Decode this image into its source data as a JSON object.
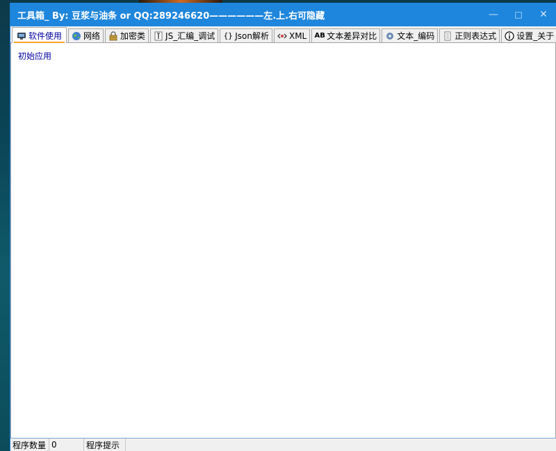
{
  "window": {
    "title": "工具箱_ By:  豆浆与油条 or QQ:289246620——————左.上.右可隐藏",
    "minimize_glyph": "—",
    "maximize_glyph": "□",
    "close_glyph": "✕"
  },
  "tabs": [
    {
      "label": "软件使用",
      "icon": "software-icon",
      "active": true
    },
    {
      "label": "网络",
      "icon": "globe-icon"
    },
    {
      "label": "加密类",
      "icon": "encrypt-icon"
    },
    {
      "label": "JS_汇编_调试",
      "icon": "js-icon"
    },
    {
      "label": "Json解析",
      "icon": "json-icon"
    },
    {
      "label": "XML",
      "icon": "xml-icon"
    },
    {
      "label": "文本差异对比",
      "icon": "text-diff-icon"
    },
    {
      "label": "文本_编码",
      "icon": "encoding-icon"
    },
    {
      "label": "正则表达式",
      "icon": "regex-icon"
    },
    {
      "label": "设置_关于",
      "icon": "info-icon"
    }
  ],
  "content": {
    "app_link": "初始应用"
  },
  "statusbar": {
    "count_label": "程序数量",
    "count_value": "0",
    "hint_label": "程序提示"
  },
  "colors": {
    "titlebar": "#1e86dc",
    "active_tab_text": "#0000a0",
    "active_tab_underline": "#f5a623"
  }
}
